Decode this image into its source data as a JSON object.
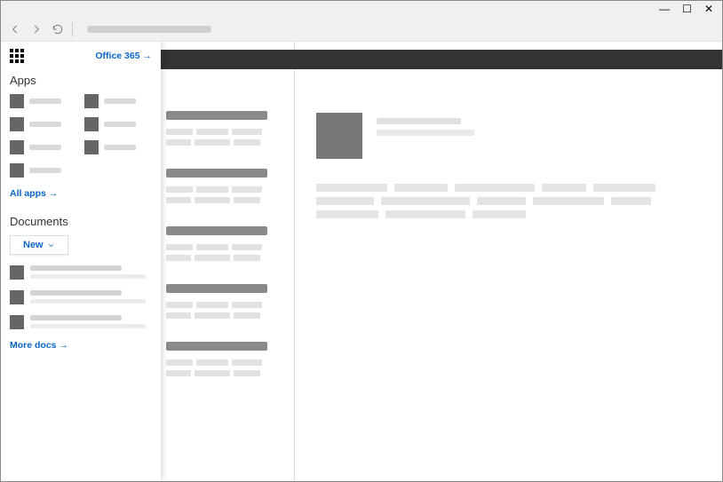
{
  "window": {
    "minimize": "—",
    "maximize": "☐",
    "close": "✕"
  },
  "sidebar": {
    "brand_link": "Office 365 →",
    "apps_title": "Apps",
    "all_apps_link": "All apps →",
    "documents_title": "Documents",
    "new_label": "New",
    "more_docs_link": "More docs →",
    "apps": [
      {
        "id": "app1"
      },
      {
        "id": "app2"
      },
      {
        "id": "app3"
      },
      {
        "id": "app4"
      },
      {
        "id": "app5"
      },
      {
        "id": "app6"
      },
      {
        "id": "app7"
      }
    ],
    "docs": [
      {
        "id": "doc1"
      },
      {
        "id": "doc2"
      },
      {
        "id": "doc3"
      }
    ]
  }
}
